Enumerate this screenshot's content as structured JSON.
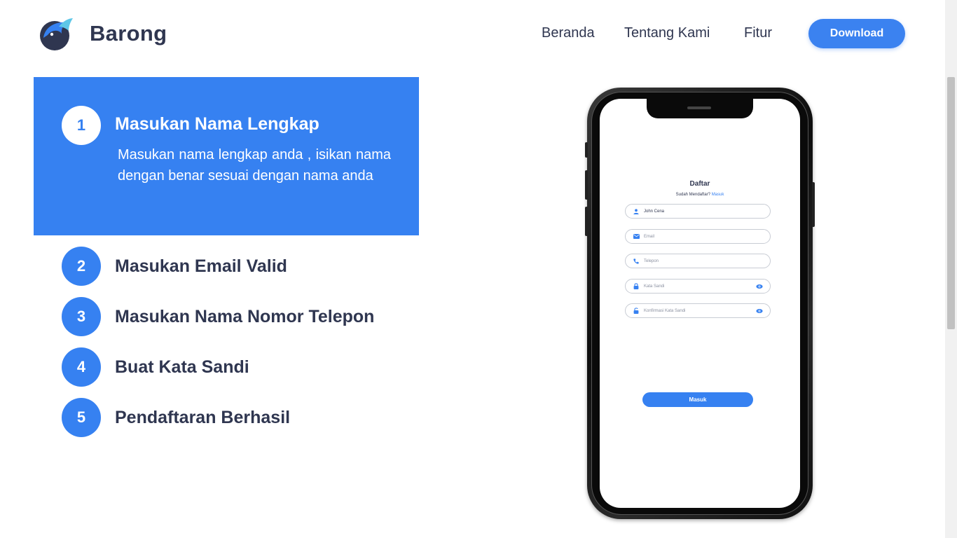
{
  "header": {
    "brand": "Barong",
    "nav": [
      "Beranda",
      "Tentang Kami",
      "Fitur"
    ],
    "download_label": "Download"
  },
  "colors": {
    "accent": "#3681f1",
    "text": "#2f3650"
  },
  "steps": [
    {
      "number": "1",
      "title": "Masukan Nama Lengkap",
      "description": "Masukan nama lengkap anda , isikan nama dengan benar sesuai dengan nama anda",
      "active": true
    },
    {
      "number": "2",
      "title": "Masukan Email Valid"
    },
    {
      "number": "3",
      "title": "Masukan Nama Nomor Telepon"
    },
    {
      "number": "4",
      "title": "Buat Kata Sandi"
    },
    {
      "number": "5",
      "title": "Pendaftaran Berhasil"
    }
  ],
  "phone": {
    "title": "Daftar",
    "subtitle": "Sudah Mendaftar?",
    "subtitle_link": "Masuk",
    "fields": [
      {
        "icon": "user-icon",
        "value": "John Cena",
        "placeholder": ""
      },
      {
        "icon": "mail-icon",
        "value": "",
        "placeholder": "Email"
      },
      {
        "icon": "phone-icon",
        "value": "",
        "placeholder": "Telepon"
      },
      {
        "icon": "lock-icon",
        "value": "",
        "placeholder": "Kata Sandi"
      },
      {
        "icon": "lock-open-icon",
        "value": "",
        "placeholder": "Konfirmasi Kata Sandi"
      }
    ],
    "button_label": "Masuk"
  }
}
